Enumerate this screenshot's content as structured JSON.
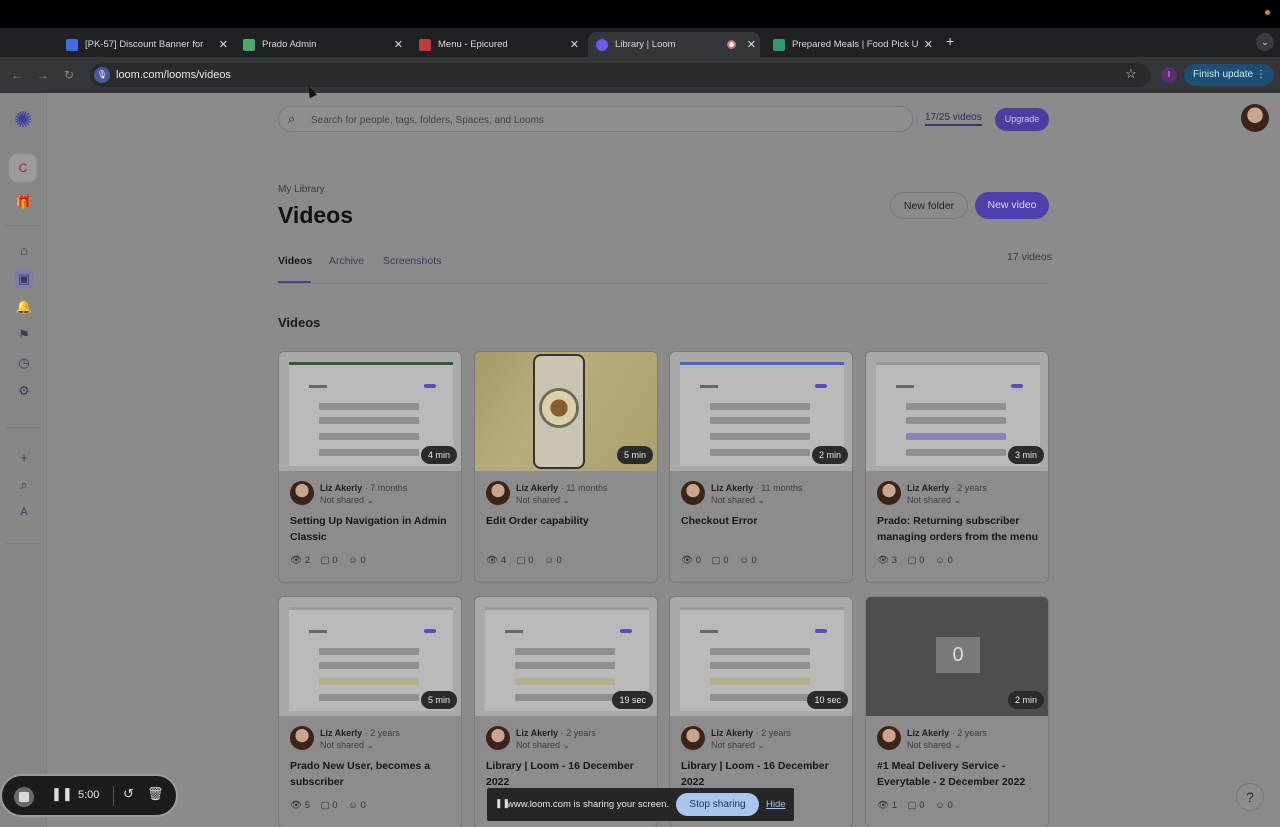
{
  "browser": {
    "tabs": [
      {
        "title": "[PK-57] Discount Banner for",
        "color": "#3b6ee8"
      },
      {
        "title": "Prado Admin",
        "color": "#4ea867"
      },
      {
        "title": "Menu - Epicured",
        "color": "#c23b3b"
      },
      {
        "title": "Library | Loom",
        "color": "#6b5cf0"
      },
      {
        "title": "Prepared Meals | Food Pick U",
        "color": "#2c9a6a"
      }
    ],
    "url": "loom.com/looms/videos",
    "profile_initial": "I",
    "finish_update": "Finish update"
  },
  "rail": {
    "workspace_initial": "C",
    "user_initial": "A"
  },
  "header": {
    "search_placeholder": "Search for people, tags, folders, Spaces, and Looms",
    "quota": "17/25 videos",
    "upgrade": "Upgrade"
  },
  "library": {
    "breadcrumb": "My Library",
    "title": "Videos",
    "new_folder": "New folder",
    "new_video": "New video",
    "tabs": [
      "Videos",
      "Archive",
      "Screenshots"
    ],
    "count": "17 videos",
    "section": "Videos"
  },
  "videos": [
    {
      "duration": "4 min",
      "author": "Liz Akerly",
      "ago": "· 7 months",
      "shared": "Not shared ⌄",
      "title": "Setting Up Navigation in Admin Classic",
      "views": "2",
      "comments": "0",
      "reactions": "0"
    },
    {
      "duration": "5 min",
      "author": "Liz Akerly",
      "ago": "· 11 months",
      "shared": "Not shared ⌄",
      "title": "Edit Order capability",
      "views": "4",
      "comments": "0",
      "reactions": "0"
    },
    {
      "duration": "2 min",
      "author": "Liz Akerly",
      "ago": "· 11 months",
      "shared": "Not shared ⌄",
      "title": "Checkout Error",
      "views": "0",
      "comments": "0",
      "reactions": "0"
    },
    {
      "duration": "3 min",
      "author": "Liz Akerly",
      "ago": "· 2 years",
      "shared": "Not shared ⌄",
      "title": "Prado: Returning subscriber managing orders from the menu",
      "views": "3",
      "comments": "0",
      "reactions": "0"
    },
    {
      "duration": "5 min",
      "author": "Liz Akerly",
      "ago": "· 2 years",
      "shared": "Not shared ⌄",
      "title": "Prado New User, becomes a subscriber",
      "views": "5",
      "comments": "0",
      "reactions": "0"
    },
    {
      "duration": "19 sec",
      "author": "Liz Akerly",
      "ago": "· 2 years",
      "shared": "Not shared ⌄",
      "title": "Library | Loom - 16 December 2022",
      "views": "",
      "comments": "",
      "reactions": ""
    },
    {
      "duration": "10 sec",
      "author": "Liz Akerly",
      "ago": "· 2 years",
      "shared": "Not shared ⌄",
      "title": "Library | Loom - 16 December 2022",
      "views": "",
      "comments": "",
      "reactions": ""
    },
    {
      "duration": "2 min",
      "author": "Liz Akerly",
      "ago": "· 2 years",
      "shared": "Not shared ⌄",
      "title": "#1 Meal Delivery Service - Everytable - 2 December 2022",
      "views": "1",
      "comments": "0",
      "reactions": "0",
      "overlay": "0"
    }
  ],
  "recorder": {
    "time": "5:00"
  },
  "share_bar": {
    "message": "www.loom.com is sharing your screen.",
    "stop": "Stop sharing",
    "hide": "Hide"
  },
  "help": "?"
}
